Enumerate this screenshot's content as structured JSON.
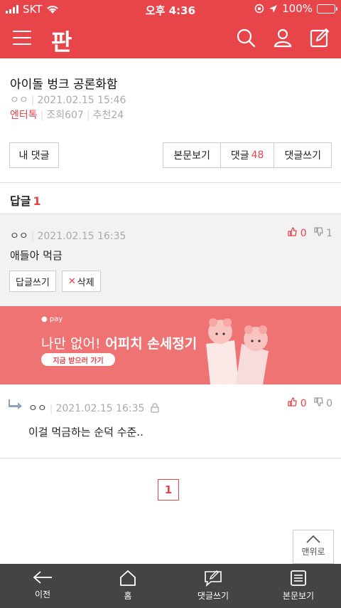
{
  "status_bar": {
    "carrier": "SKT",
    "time": "오후 4:36",
    "battery": "100%"
  },
  "header": {
    "logo": "판"
  },
  "post": {
    "title": "아이돌 벙크 공론화함",
    "author": "ㅇㅇ",
    "date": "2021.02.15 15:46",
    "category": "엔터톡",
    "views": "조회607",
    "likes": "추천24"
  },
  "actions": {
    "my_comments": "내 댓글",
    "view_post": "본문보기",
    "comments_label": "댓글",
    "comments_count": "48",
    "write_comment": "댓글쓰기"
  },
  "replies_section": {
    "label": "답글",
    "count": "1"
  },
  "comment": {
    "author": "ㅇㅇ",
    "date": "2021.02.15 16:35",
    "text": "애들아 먹금",
    "up": "0",
    "down": "1",
    "reply_button": "답글쓰기",
    "delete_button": "삭제"
  },
  "banner": {
    "pay_label": "pay",
    "headline_light": "나만 없어!",
    "headline_bold": "어피치 손세정기",
    "cta": "지금 받으러 가기"
  },
  "reply": {
    "author": "ㅇㅇ",
    "date": "2021.02.15 16:35",
    "text": "이걸 먹금하는 순덕 수준..",
    "up": "0",
    "down": "0"
  },
  "pagination": {
    "current": "1"
  },
  "to_top": {
    "label": "맨위로"
  },
  "bottom_nav": [
    {
      "label": "이전",
      "icon": "back-arrow-icon"
    },
    {
      "label": "홈",
      "icon": "home-icon"
    },
    {
      "label": "댓글쓰기",
      "icon": "write-comment-icon"
    },
    {
      "label": "본문보기",
      "icon": "document-icon"
    }
  ],
  "colors": {
    "brand": "#e8454b",
    "banner": "#f07374",
    "nav": "#444444"
  }
}
